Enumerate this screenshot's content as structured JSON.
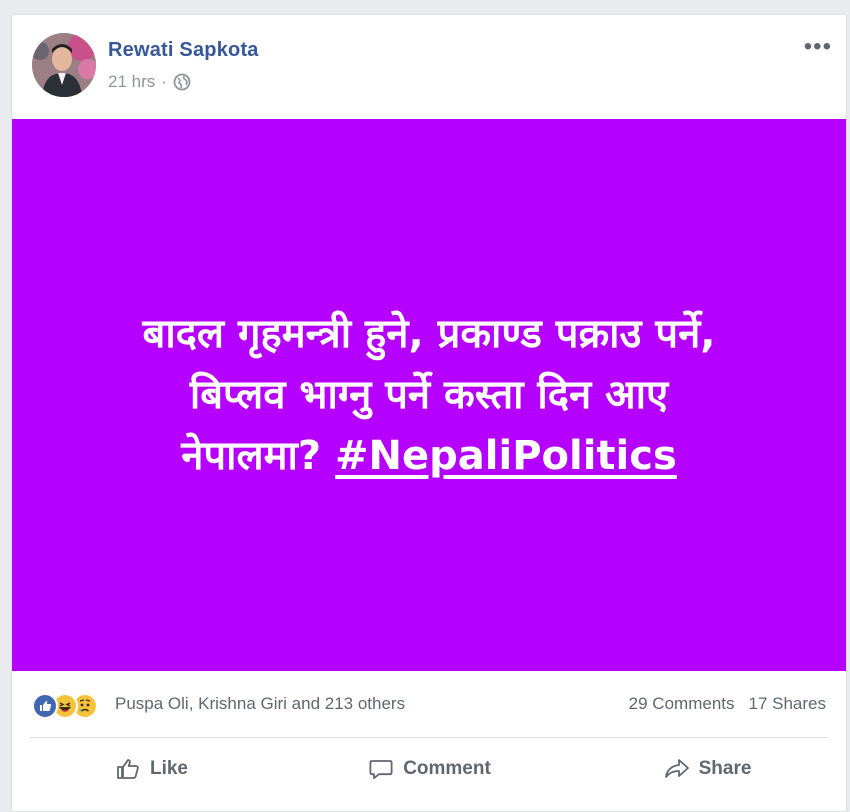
{
  "post": {
    "author": "Rewati Sapkota",
    "time": "21 hrs",
    "separator": "·",
    "more_label": "•••",
    "privacy_icon": "globe-icon",
    "background_color": "#b600ff",
    "text_lines": [
      "बादल गृहमन्त्री हुने, प्रकाण्ड पक्राउ पर्ने,",
      "बिप्लव भाग्नु पर्ने कस्ता दिन आए",
      "नेपालमा?"
    ],
    "hashtag": "#NepaliPolitics"
  },
  "reactions": {
    "icons": [
      "like-icon",
      "haha-icon",
      "sad-icon"
    ],
    "names": "Puspa Oli, Krishna Giri and 213 others",
    "comments": "29 Comments",
    "shares": "17 Shares"
  },
  "actions": {
    "like": "Like",
    "comment": "Comment",
    "share": "Share"
  },
  "colors": {
    "link": "#365899",
    "muted": "#606770",
    "like_blue": "#4267b2",
    "emoji_yellow": "#f5c33b"
  }
}
